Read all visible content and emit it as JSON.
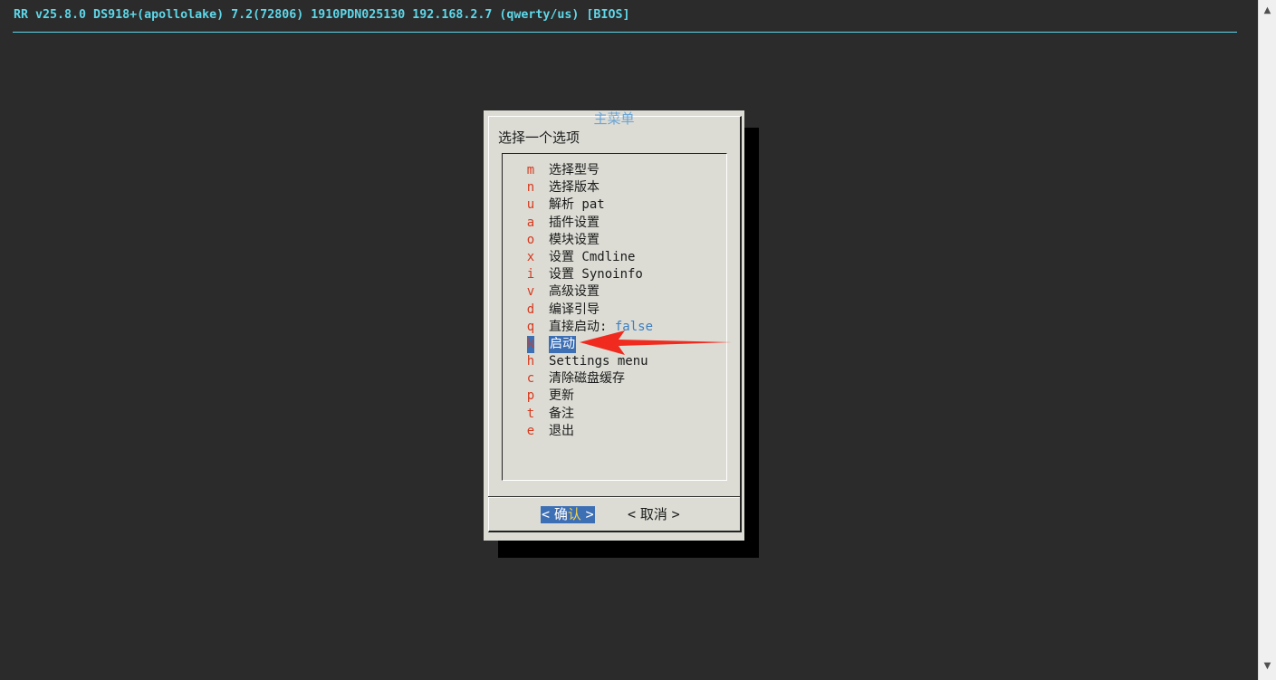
{
  "header": {
    "title": "RR v25.8.0 DS918+(apollolake) 7.2(72806) 1910PDN025130 192.168.2.7 (qwerty/us) [BIOS]"
  },
  "dialog": {
    "title": "主菜单",
    "prompt": "选择一个选项",
    "items": [
      {
        "key": "m",
        "label": "选择型号"
      },
      {
        "key": "n",
        "label": "选择版本"
      },
      {
        "key": "u",
        "label": "解析 pat"
      },
      {
        "key": "a",
        "label": "插件设置"
      },
      {
        "key": "o",
        "label": "模块设置"
      },
      {
        "key": "x",
        "label": "设置 Cmdline"
      },
      {
        "key": "i",
        "label": "设置 Synoinfo"
      },
      {
        "key": "v",
        "label": "高级设置"
      },
      {
        "key": "d",
        "label": "编译引导"
      },
      {
        "key": "q",
        "label": "直接启动:",
        "value": "false"
      },
      {
        "key": "k",
        "label": "启动",
        "selected": true
      },
      {
        "key": "h",
        "label": "Settings menu"
      },
      {
        "key": "c",
        "label": "清除磁盘缓存"
      },
      {
        "key": "p",
        "label": "更新"
      },
      {
        "key": "t",
        "label": "备注"
      },
      {
        "key": "e",
        "label": "退出"
      }
    ],
    "buttons": {
      "ok_bracket_left": "<",
      "ok_first": "确",
      "ok_hot": "认",
      "ok_bracket_right": ">",
      "cancel_bracket_left": "<",
      "cancel_label": "取消",
      "cancel_bracket_right": ">"
    }
  },
  "annotation": {
    "arrow_color": "#f02a1e"
  },
  "colors": {
    "background": "#2b2b2b",
    "header": "#5fd7e8",
    "dialog": "#dcdcd5",
    "key": "#d63a1e",
    "selection": "#3d6fb4",
    "title": "#6aa4d6"
  }
}
